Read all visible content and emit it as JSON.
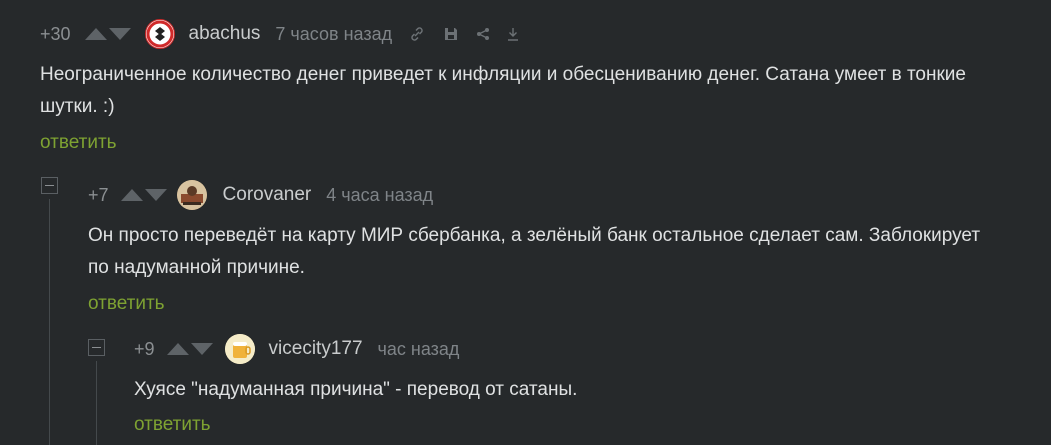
{
  "comments": [
    {
      "rating": "+30",
      "author": "abachus",
      "time": "7 часов назад",
      "text": "Неограниченное количество денег приведет к инфляции и обесцениванию денег. Сатана умеет в тонкие шутки. :)",
      "reply_label": "ответить"
    },
    {
      "rating": "+7",
      "author": "Corovaner",
      "time": "4 часа назад",
      "text": "Он просто переведёт на карту МИР сбербанка, а зелёный банк остальное сделает сам. Заблокирует по надуманной причине.",
      "reply_label": "ответить"
    },
    {
      "rating": "+9",
      "author": "vicecity177",
      "time": "час назад",
      "text": "Хуясе \"надуманная причина\" - перевод от сатаны.",
      "reply_label": "ответить"
    }
  ],
  "icons": [
    "upvote-icon",
    "downvote-icon",
    "link-icon",
    "save-icon",
    "share-icon",
    "download-icon",
    "collapse-icon"
  ],
  "colors": {
    "background": "#26292b",
    "accent_green": "#7ea232",
    "muted": "#7f8488"
  }
}
